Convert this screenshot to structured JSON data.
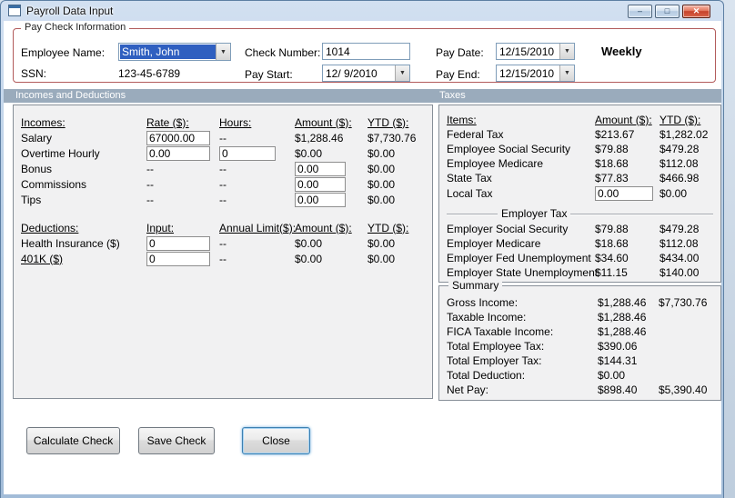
{
  "window": {
    "title": "Payroll Data Input"
  },
  "icons": {
    "minimize": "–",
    "maximize": "□",
    "close": "✕",
    "dropdown": "▼"
  },
  "colors": {
    "selection": "#2f5fc0",
    "band": "#9aabbc",
    "group_border": "#b25b5b"
  },
  "paycheck": {
    "group_title": "Pay Check Information",
    "employee_name": {
      "label": "Employee Name:",
      "value": "Smith, John"
    },
    "ssn": {
      "label": "SSN:",
      "value": "123-45-6789"
    },
    "check_number": {
      "label": "Check Number:",
      "value": "1014"
    },
    "pay_start": {
      "label": "Pay Start:",
      "value": "12/ 9/2010"
    },
    "pay_date": {
      "label": "Pay Date:",
      "value": "12/15/2010"
    },
    "pay_end": {
      "label": "Pay End:",
      "value": "12/15/2010"
    },
    "frequency": "Weekly"
  },
  "section_headers": {
    "left": "Incomes and Deductions",
    "right": "Taxes"
  },
  "incomes": {
    "headers": {
      "col0": "Incomes:",
      "col1": "Rate ($):",
      "col2": "Hours:",
      "col3": "Amount ($):",
      "col4": "YTD ($):"
    },
    "rows": [
      {
        "label": "Salary",
        "rate": "67000.00",
        "hours": "--",
        "amount": "$1,288.46",
        "ytd": "$7,730.76"
      },
      {
        "label": "Overtime Hourly",
        "rate": "0.00",
        "hours": "0",
        "amount": "$0.00",
        "ytd": "$0.00"
      },
      {
        "label": "Bonus",
        "rate": "--",
        "hours": "--",
        "amount": "0.00",
        "ytd": "$0.00"
      },
      {
        "label": "Commissions",
        "rate": "--",
        "hours": "--",
        "amount": "0.00",
        "ytd": "$0.00"
      },
      {
        "label": "Tips",
        "rate": "--",
        "hours": "--",
        "amount": "0.00",
        "ytd": "$0.00"
      }
    ]
  },
  "deductions": {
    "headers": {
      "col0": "Deductions:",
      "col1": "Input:",
      "col2": "Annual Limit($):",
      "col3": "Amount ($):",
      "col4": "YTD ($):"
    },
    "rows": [
      {
        "label": "Health Insurance  ($)",
        "input": "0",
        "limit": "--",
        "amount": "$0.00",
        "ytd": "$0.00"
      },
      {
        "label": "401K  ($)",
        "input": "0",
        "limit": "--",
        "amount": "$0.00",
        "ytd": "$0.00"
      }
    ]
  },
  "taxes": {
    "headers": {
      "col0": "Items:",
      "col1": "Amount ($):",
      "col2": "YTD ($):"
    },
    "employee_rows": [
      {
        "label": "Federal Tax",
        "amount": "$213.67",
        "ytd": "$1,282.02"
      },
      {
        "label": "Employee Social Security",
        "amount": "$79.88",
        "ytd": "$479.28"
      },
      {
        "label": "Employee Medicare",
        "amount": "$18.68",
        "ytd": "$112.08"
      },
      {
        "label": "State Tax",
        "amount": "$77.83",
        "ytd": "$466.98"
      }
    ],
    "local_tax": {
      "label": "Local Tax",
      "amount": "0.00",
      "ytd": "$0.00"
    },
    "employer_header": "Employer Tax",
    "employer_rows": [
      {
        "label": "Employer Social Security",
        "amount": "$79.88",
        "ytd": "$479.28"
      },
      {
        "label": "Employer Medicare",
        "amount": "$18.68",
        "ytd": "$112.08"
      },
      {
        "label": "Employer Fed Unemployment",
        "amount": "$34.60",
        "ytd": "$434.00"
      },
      {
        "label": "Employer State Unemployment",
        "amount": "$11.15",
        "ytd": "$140.00"
      }
    ]
  },
  "summary": {
    "group_title": "Summary",
    "rows": [
      {
        "label": "Gross Income:",
        "amount": "$1,288.46",
        "ytd": "$7,730.76"
      },
      {
        "label": "Taxable Income:",
        "amount": "$1,288.46",
        "ytd": ""
      },
      {
        "label": "FICA Taxable Income:",
        "amount": "$1,288.46",
        "ytd": ""
      },
      {
        "label": "Total Employee Tax:",
        "amount": "$390.06",
        "ytd": ""
      },
      {
        "label": "Total Employer Tax:",
        "amount": "$144.31",
        "ytd": ""
      },
      {
        "label": "Total Deduction:",
        "amount": "$0.00",
        "ytd": ""
      },
      {
        "label": "Net Pay:",
        "amount": "$898.40",
        "ytd": "$5,390.40"
      }
    ]
  },
  "buttons": {
    "calculate": "Calculate Check",
    "save": "Save Check",
    "close": "Close"
  }
}
